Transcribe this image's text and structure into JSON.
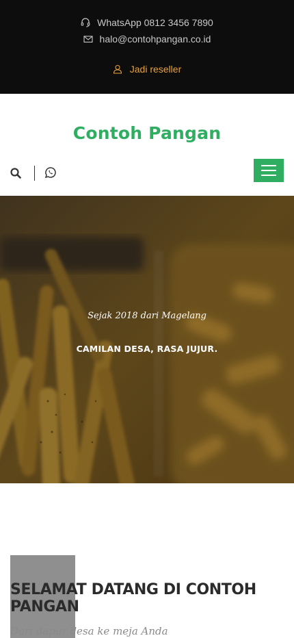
{
  "topbar": {
    "whatsapp": "WhatsApp 0812 3456 7890",
    "email": "halo@contohpangan.co.id",
    "reseller": "Jadi reseller",
    "reseller_color": "#e9a23b"
  },
  "header": {
    "brand": "Contoh Pangan",
    "brand_color": "#2fae62",
    "icons": [
      "search-icon",
      "whatsapp-icon",
      "hamburger-menu-icon"
    ]
  },
  "hero": {
    "subtitle": "Sejak 2018 dari Magelang",
    "title": "CAMILAN DESA, RASA JUJUR."
  },
  "welcome": {
    "heading": "SELAMAT DATANG DI CONTOH PANGAN",
    "tagline": "Dari dapur desa ke meja Anda"
  }
}
